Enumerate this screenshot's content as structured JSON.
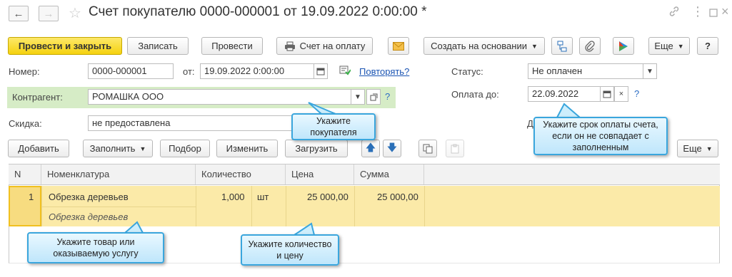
{
  "titlebar": {
    "title": "Счет покупателю 0000-000001 от 19.09.2022 0:00:00 *",
    "back_icon": "arrow-left-icon",
    "forward_icon": "arrow-right-icon",
    "favorite_icon": "star-icon",
    "window_icons": [
      "link-icon",
      "more-vertical-icon",
      "maximize-icon",
      "close-icon"
    ]
  },
  "toolbar": {
    "post_close": "Провести и закрыть",
    "save": "Записать",
    "post": "Провести",
    "invoice": "Счет на оплату",
    "create_based": "Создать на основании",
    "more": "Еще",
    "help": "?"
  },
  "form": {
    "number_label": "Номер:",
    "number_value": "0000-000001",
    "date_label": "от:",
    "date_value": "19.09.2022  0:00:00",
    "repeat_link": "Повторять?",
    "status_label": "Статус:",
    "status_value": "Не оплачен",
    "counterparty_label": "Контрагент:",
    "counterparty_value": "РОМАШКА ООО",
    "pay_until_label": "Оплата до:",
    "pay_until_value": "22.09.2022",
    "discount_label": "Скидка:",
    "discount_value": "не предоставлена",
    "hidden_label_initial": "Д",
    "help_q": "?"
  },
  "table_toolbar": {
    "add": "Добавить",
    "fill": "Заполнить",
    "select": "Подбор",
    "change": "Изменить",
    "load": "Загрузить",
    "more": "Еще"
  },
  "table": {
    "columns": [
      "N",
      "Номенклатура",
      "Количество",
      "Цена",
      "Сумма"
    ],
    "rows": [
      {
        "n": "1",
        "nomenclature": "Обрезка деревьев",
        "content": "Обрезка деревьев",
        "quantity": "1,000",
        "unit": "шт",
        "price": "25 000,00",
        "sum": "25 000,00"
      }
    ]
  },
  "callouts": {
    "buyer": "Укажите покупателя",
    "due_date": "Укажите срок оплаты счета, если он не совпадает с заполненным",
    "product": "Укажите товар или оказываемую услугу",
    "qty_price": "Укажите количество и цену"
  },
  "colors": {
    "primary_button": "#f5d20f",
    "green_band": "#d6ecc6",
    "selected_row": "#fbeaa8",
    "callout_border": "#3aa6dd",
    "link": "#1a54b3"
  }
}
